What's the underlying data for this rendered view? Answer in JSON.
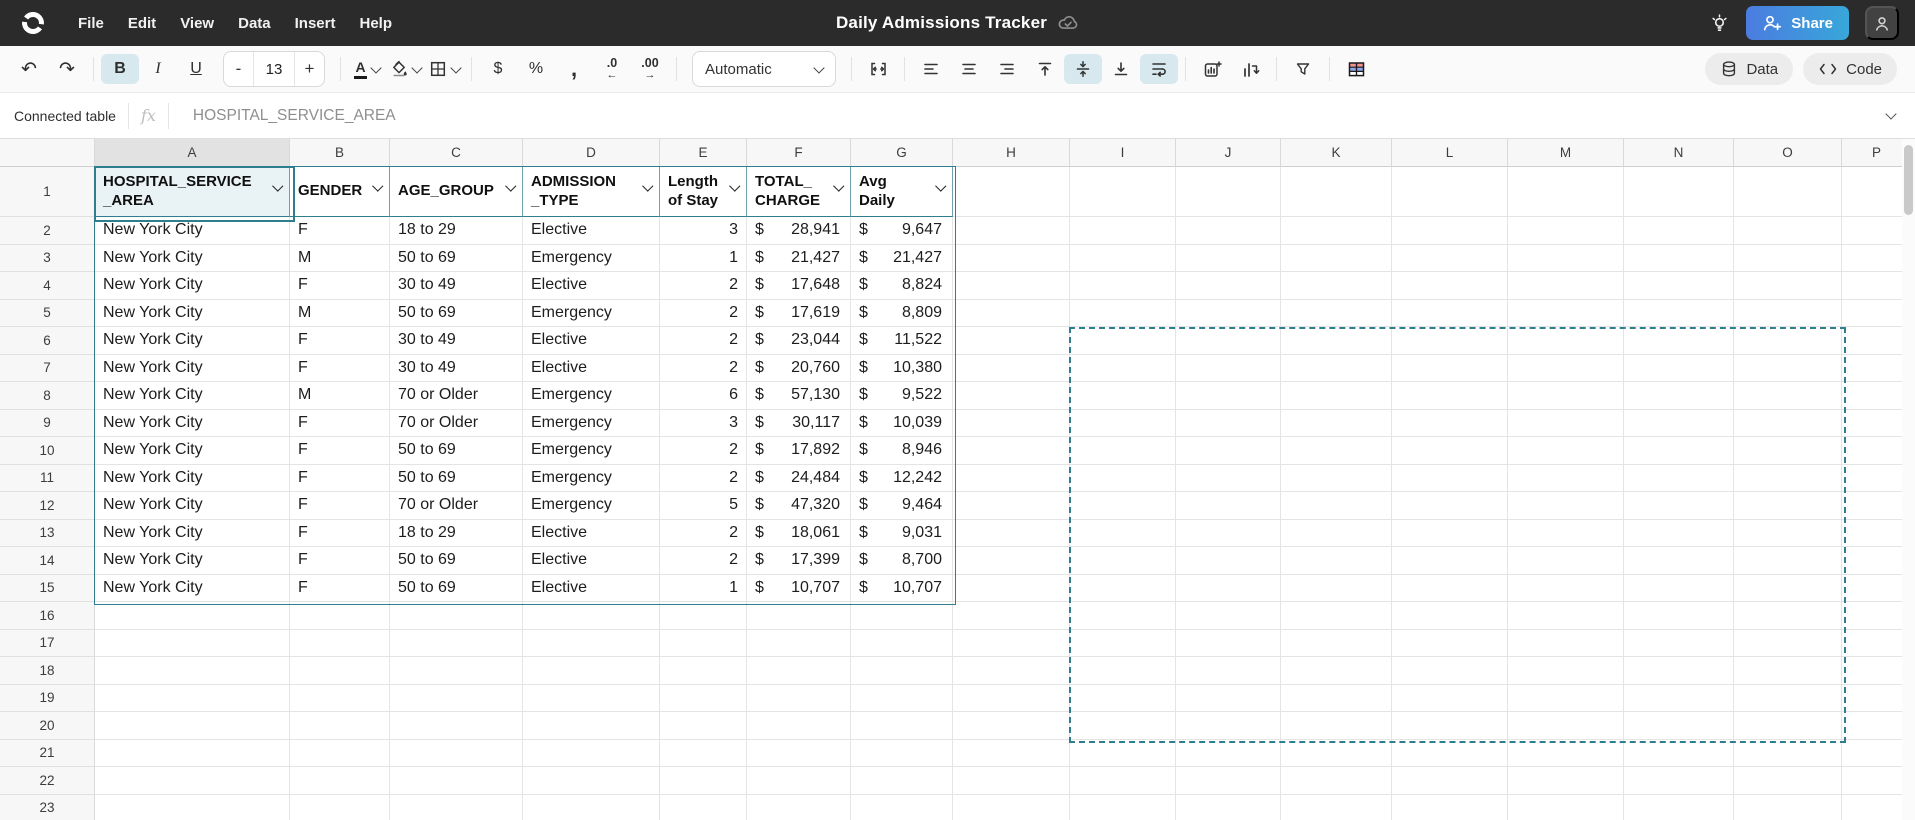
{
  "colors": {
    "titlebar_bg": "#2b2b2b",
    "accent": "#2e7e90",
    "selection_fill": "#e9f3f6",
    "active_tool": "#d7e9ef",
    "share_start": "#4b7ce0",
    "share_end": "#38a7d9"
  },
  "titlebar": {
    "menus": [
      "File",
      "Edit",
      "View",
      "Data",
      "Insert",
      "Help"
    ],
    "title": "Daily Admissions Tracker",
    "share_label": "Share"
  },
  "toolbar": {
    "bold": "B",
    "italic": "I",
    "underline": "U",
    "font_size_decrease": "-",
    "font_size": "13",
    "font_size_increase": "+",
    "text_color_letter": "A",
    "currency": "$",
    "percent": "%",
    "comma": ",",
    "dec_decrease": ".0",
    "dec_decrease_arrow": "←",
    "dec_increase": ".00",
    "dec_increase_arrow": "→",
    "format_mode": "Automatic",
    "undo_glyph": "↶",
    "redo_glyph": "↷",
    "data_label": "Data",
    "code_label": "Code"
  },
  "formula_bar": {
    "context_label": "Connected table",
    "fx_label": "fx",
    "value": "HOSPITAL_SERVICE_AREA"
  },
  "sheet": {
    "column_letters": [
      "A",
      "B",
      "C",
      "D",
      "E",
      "F",
      "G",
      "H",
      "I",
      "J",
      "K",
      "L",
      "M",
      "N",
      "O",
      "P"
    ],
    "row_numbers": [
      "1",
      "2",
      "3",
      "4",
      "5",
      "6",
      "7",
      "8",
      "9",
      "10",
      "11",
      "12",
      "13",
      "14",
      "15",
      "16",
      "17",
      "18",
      "19",
      "20",
      "21",
      "22",
      "23"
    ],
    "headers": [
      "HOSPITAL_SERVICE\n_AREA",
      "GENDER",
      "AGE_GROUP",
      "ADMISSION\n_TYPE",
      "Length\nof Stay",
      "TOTAL_\nCHARGE",
      "Avg\nDaily"
    ],
    "currency_symbol": "$",
    "data": [
      [
        "New York City",
        "F",
        "18 to 29",
        "Elective",
        "3",
        "28,941",
        "9,647"
      ],
      [
        "New York City",
        "M",
        "50 to 69",
        "Emergency",
        "1",
        "21,427",
        "21,427"
      ],
      [
        "New York City",
        "F",
        "30 to 49",
        "Elective",
        "2",
        "17,648",
        "8,824"
      ],
      [
        "New York City",
        "M",
        "50 to 69",
        "Emergency",
        "2",
        "17,619",
        "8,809"
      ],
      [
        "New York City",
        "F",
        "30 to 49",
        "Elective",
        "2",
        "23,044",
        "11,522"
      ],
      [
        "New York City",
        "F",
        "30 to 49",
        "Elective",
        "2",
        "20,760",
        "10,380"
      ],
      [
        "New York City",
        "M",
        "70 or Older",
        "Emergency",
        "6",
        "57,130",
        "9,522"
      ],
      [
        "New York City",
        "F",
        "70 or Older",
        "Emergency",
        "3",
        "30,117",
        "10,039"
      ],
      [
        "New York City",
        "F",
        "50 to 69",
        "Emergency",
        "2",
        "17,892",
        "8,946"
      ],
      [
        "New York City",
        "F",
        "50 to 69",
        "Emergency",
        "2",
        "24,484",
        "12,242"
      ],
      [
        "New York City",
        "F",
        "70 or Older",
        "Emergency",
        "5",
        "47,320",
        "9,464"
      ],
      [
        "New York City",
        "F",
        "18 to 29",
        "Elective",
        "2",
        "18,061",
        "9,031"
      ],
      [
        "New York City",
        "F",
        "50 to 69",
        "Elective",
        "2",
        "17,399",
        "8,700"
      ],
      [
        "New York City",
        "F",
        "50 to 69",
        "Elective",
        "1",
        "10,707",
        "10,707"
      ]
    ]
  }
}
